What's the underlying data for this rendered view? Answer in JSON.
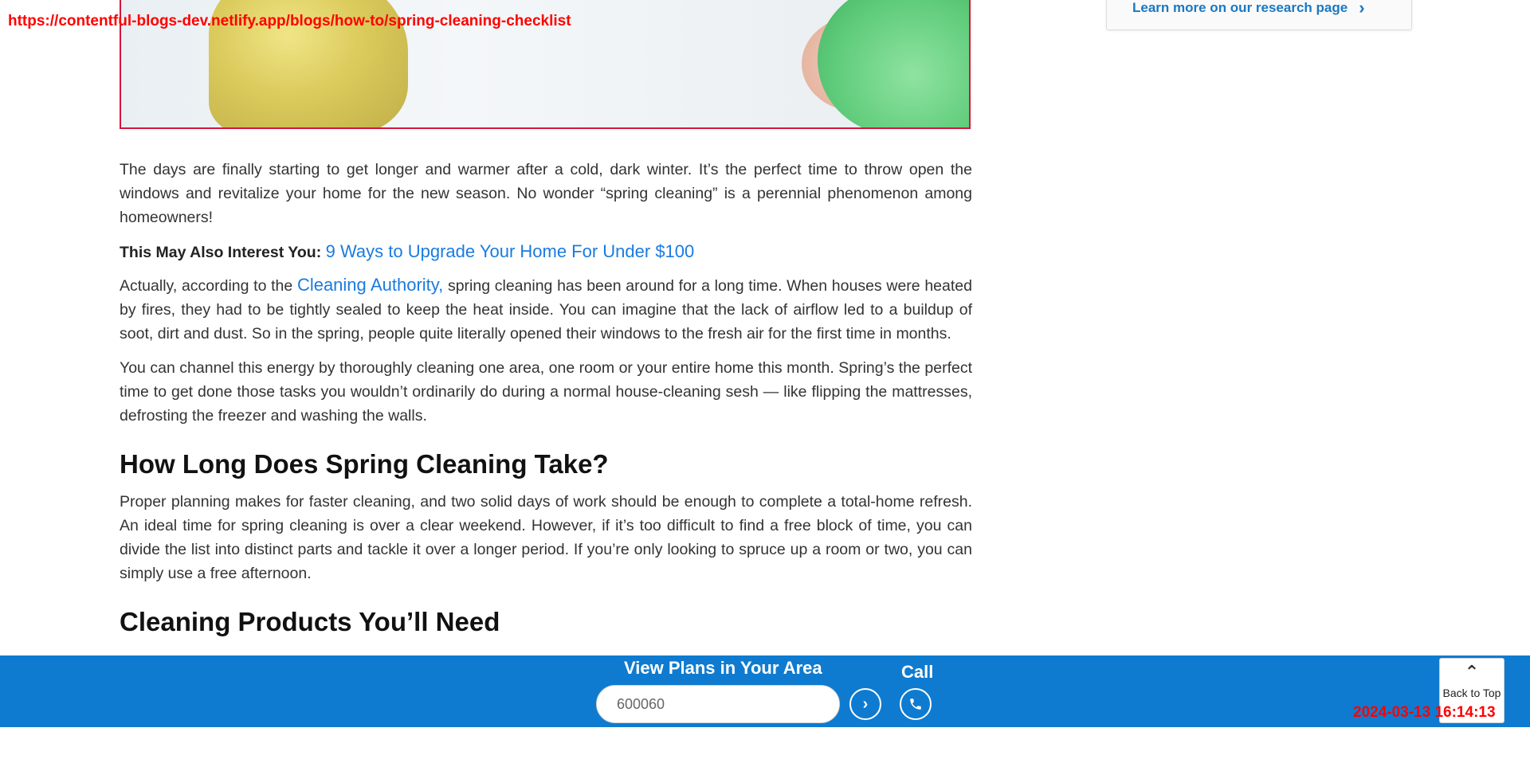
{
  "overlay": {
    "url": "https://contentful-blogs-dev.netlify.app/blogs/how-to/spring-cleaning-checklist",
    "timestamp": "2024-03-13 16:14:13"
  },
  "sidebar": {
    "research_link": "Learn more on our research page",
    "research_icon": "chevron-right-icon"
  },
  "article": {
    "p1": "The days are finally starting to get longer and warmer after a cold, dark winter. It’s the perfect time to throw open the windows and revitalize your home for the new season.  No wonder “spring cleaning” is a perennial phenomenon among homeowners!",
    "interest_label": "This May Also Interest You:",
    "interest_link": "9 Ways to Upgrade Your Home For Under $100",
    "p2_before": "Actually, according to the ",
    "p2_link": "Cleaning Authority,",
    "p2_after": " spring cleaning has been around for a long time. When houses were heated by fires, they had to be tightly sealed to keep the heat inside. You can imagine that the lack of airflow led to a buildup of soot, dirt and dust. So in the spring, people quite literally opened their windows to the fresh air for the first time in months.",
    "p3": "You can channel this energy by thoroughly cleaning one area, one room or your entire home this month. Spring’s the perfect time to get done those tasks you wouldn’t ordinarily do during a normal house-cleaning sesh — like flipping the mattresses, defrosting the freezer and washing the walls.",
    "h2_1": "How Long Does Spring Cleaning Take?",
    "p4": "Proper planning makes for faster cleaning, and two solid days of work should be enough to complete a total-home refresh. An ideal time for spring cleaning is over a clear weekend. However, if it’s too difficult to find a free block of time, you can divide the list into distinct parts and tackle it over a longer period. If you’re only looking to spruce up a room or two, you can simply use a free afternoon.",
    "h2_2": "Cleaning Products You’ll Need"
  },
  "bottom_bar": {
    "title": "View Plans in Your Area",
    "zip_value": "600060",
    "go_icon": "chevron-right-icon",
    "call_label": "Call",
    "call_icon": "phone-icon",
    "accent_color": "#0e7bd0"
  },
  "back_to_top": {
    "label": "Back to Top",
    "icon": "chevron-up-icon"
  }
}
